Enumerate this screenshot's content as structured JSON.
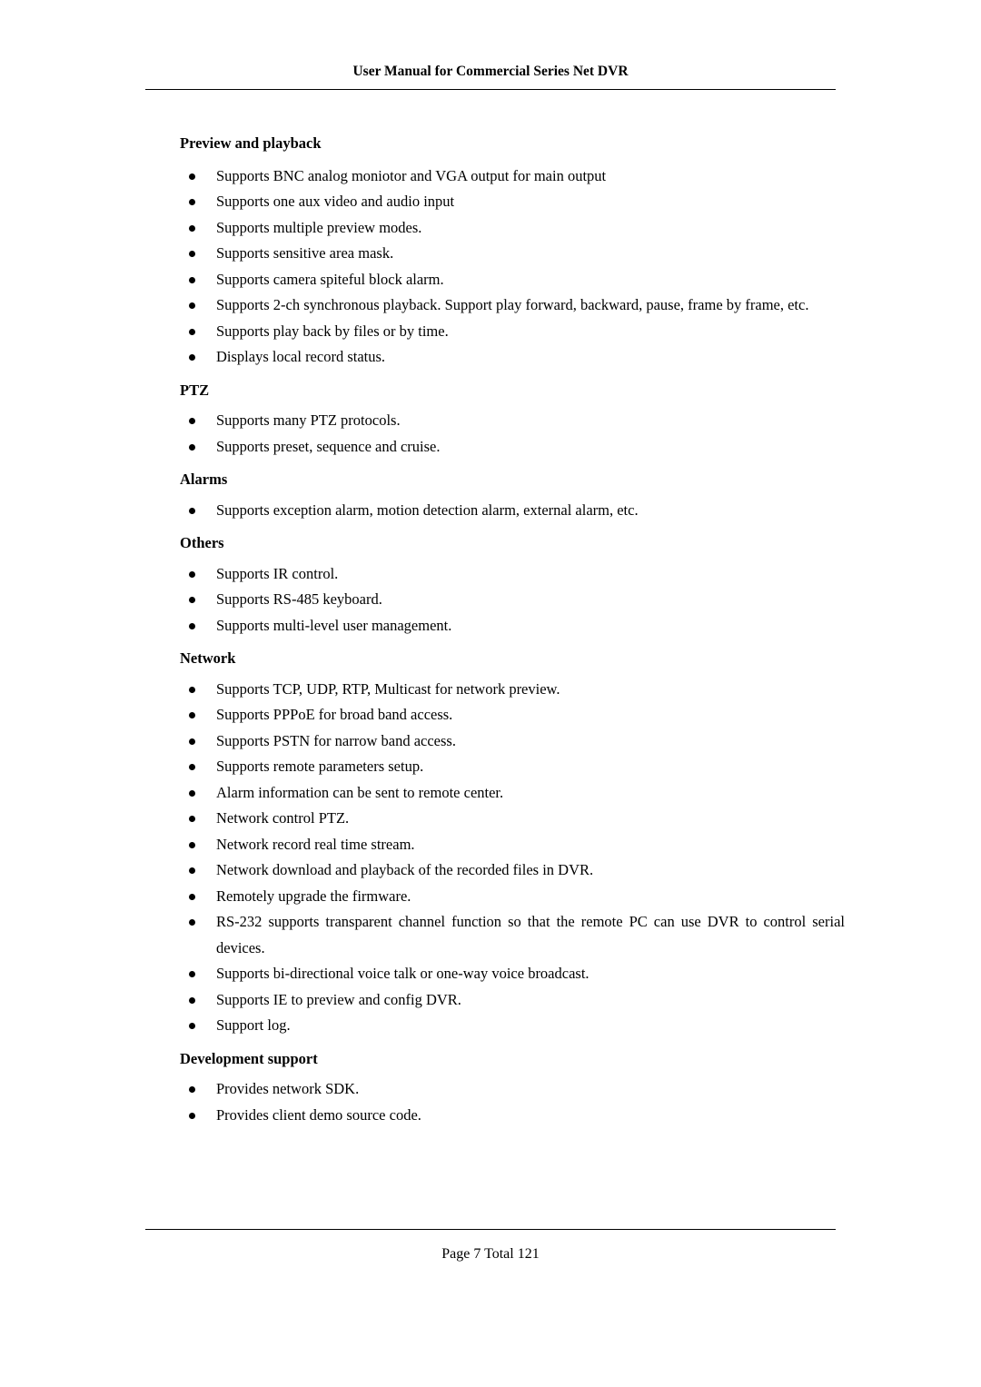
{
  "header": {
    "title": "User Manual for Commercial Series Net DVR"
  },
  "footer": {
    "page_label": "Page",
    "page_number": "7",
    "total_label": "Total",
    "total_pages": "121"
  },
  "sections": [
    {
      "title": "Preview and playback",
      "items": [
        "Supports BNC analog moniotor and VGA output for main output",
        "Supports one aux video and audio input",
        "Supports multiple preview modes.",
        "Supports sensitive area mask.",
        "Supports camera spiteful block alarm.",
        "Supports 2-ch synchronous playback. Support play forward, backward, pause, frame by frame, etc.",
        "Supports play back by files or by time.",
        "Displays local record status."
      ]
    },
    {
      "title": "PTZ",
      "items": [
        "Supports many PTZ protocols.",
        "Supports preset, sequence and cruise."
      ]
    },
    {
      "title": "Alarms",
      "items": [
        "Supports exception alarm, motion detection alarm, external alarm, etc."
      ]
    },
    {
      "title": "Others",
      "items": [
        "Supports IR control.",
        "Supports RS-485 keyboard.",
        "Supports multi-level user management."
      ]
    },
    {
      "title": "Network",
      "items": [
        "Supports TCP, UDP, RTP, Multicast for network preview.",
        "Supports PPPoE for broad band access.",
        "Supports PSTN for narrow band access.",
        "Supports remote parameters setup.",
        "Alarm information can be sent to remote center.",
        "Network control PTZ.",
        "Network record real time stream.",
        "Network download and playback of the recorded files in DVR.",
        "Remotely upgrade the firmware.",
        "RS-232 supports transparent channel function so that the remote PC can use DVR to control serial devices.",
        "Supports bi-directional voice talk or one-way voice broadcast.",
        "Supports IE to preview and config DVR.",
        "Support log."
      ]
    },
    {
      "title": "Development support",
      "items": [
        "Provides network SDK.",
        "Provides client demo source code."
      ]
    }
  ]
}
